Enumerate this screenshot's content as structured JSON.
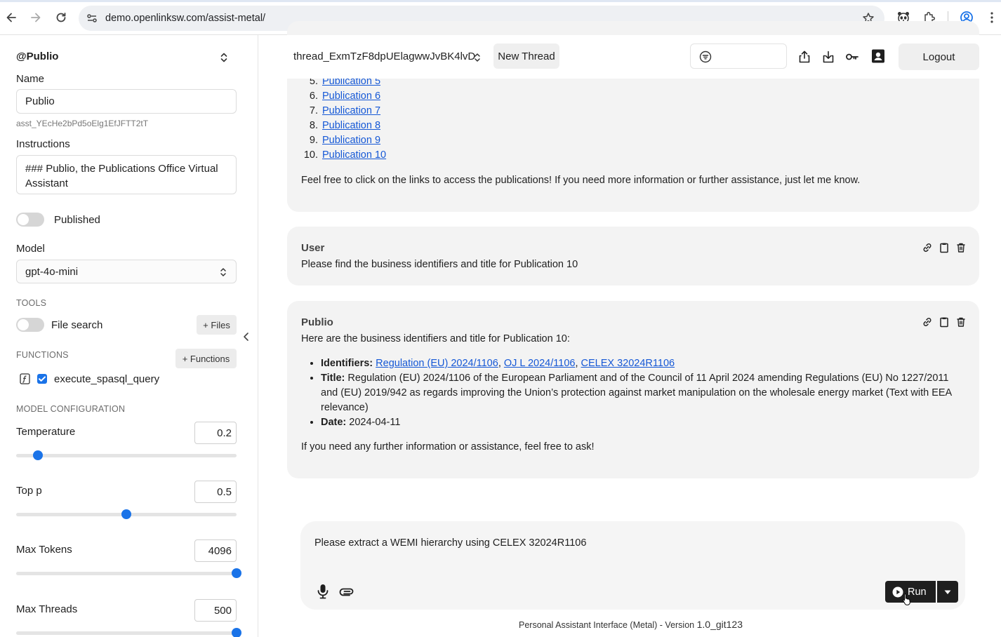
{
  "browser": {
    "url": "demo.openlinksw.com/assist-metal/"
  },
  "sidebar": {
    "assistant_handle": "@Publio",
    "name_label": "Name",
    "name_value": "Publio",
    "assistant_id": "asst_YEcHe2bPd5oElg1EfJFTT2tT",
    "instructions_label": "Instructions",
    "instructions_value": "### Publio, the Publications Office Virtual Assistant",
    "published_label": "Published",
    "published_on": false,
    "model_label": "Model",
    "model_value": "gpt-4o-mini",
    "tools_section": "TOOLS",
    "file_search_label": "File search",
    "file_search_on": false,
    "files_button": "+ Files",
    "functions_section": "FUNCTIONS",
    "functions_button": "+ Functions",
    "function_name": "execute_spasql_query",
    "function_checked": true,
    "model_config_section": "MODEL CONFIGURATION",
    "temperature_label": "Temperature",
    "temperature_value": "0.2",
    "temperature_fraction": 0.1,
    "top_p_label": "Top p",
    "top_p_value": "0.5",
    "top_p_fraction": 0.5,
    "max_tokens_label": "Max Tokens",
    "max_tokens_value": "4096",
    "max_tokens_fraction": 1.0,
    "max_threads_label": "Max Threads",
    "max_threads_value": "500",
    "max_threads_fraction": 1.0
  },
  "header": {
    "thread_id": "thread_ExmTzF8dpUElagwwJvBK4lvD",
    "new_thread_label": "New Thread",
    "logout_label": "Logout"
  },
  "messages": {
    "first": {
      "publications": [
        "Publication 5",
        "Publication 6",
        "Publication 7",
        "Publication 8",
        "Publication 9",
        "Publication 10"
      ],
      "closing": "Feel free to click on the links to access the publications! If you need more information or further assistance, just let me know."
    },
    "user": {
      "author": "User",
      "text": "Please find the business identifiers and title for Publication 10"
    },
    "assistant": {
      "author": "Publio",
      "intro": "Here are the business identifiers and title for Publication 10:",
      "identifiers_label": "Identifiers:",
      "identifier_links": [
        "Regulation (EU) 2024/1106",
        "OJ L 2024/1106",
        "CELEX 32024R1106"
      ],
      "title_label": "Title:",
      "title_text": "Regulation (EU) 2024/1106 of the European Parliament and of the Council of 11 April 2024 amending Regulations (EU) No 1227/2011 and (EU) 2019/942 as regards improving the Union’s protection against market manipulation on the wholesale energy market (Text with EEA relevance)",
      "date_label": "Date:",
      "date_value": "2024-04-11",
      "closing": "If you need any further information or assistance, feel free to ask!"
    }
  },
  "composer": {
    "prompt_text": "Please extract a WEMI hierarchy using CELEX 32024R1106",
    "run_label": "Run"
  },
  "footer": {
    "text": "Personal Assistant Interface (Metal) - Version",
    "version": "1.0_git123"
  },
  "colors": {
    "link": "#1558d6",
    "accent": "#1a73e8",
    "message_bg": "#f3f3f3",
    "run_bg": "#1f1f1f"
  }
}
